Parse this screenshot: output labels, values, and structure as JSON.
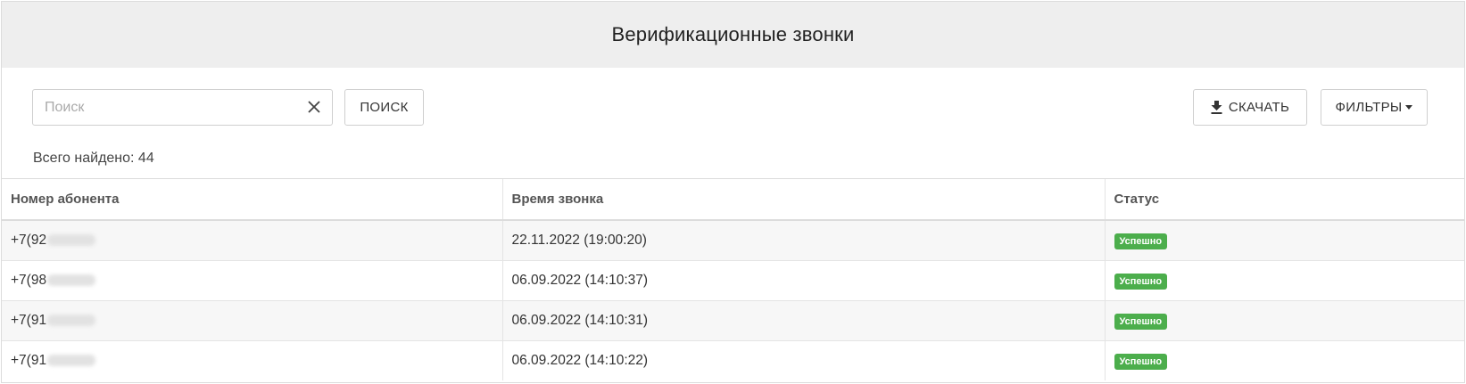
{
  "header": {
    "title": "Верификационные звонки"
  },
  "search": {
    "placeholder": "Поиск",
    "value": ""
  },
  "toolbar": {
    "search_label": "ПОИСК",
    "download_label": "СКАЧАТЬ",
    "filters_label": "ФИЛЬТРЫ"
  },
  "total": {
    "text": "Всего найдено: 44"
  },
  "table": {
    "columns": [
      "Номер абонента",
      "Время звонка",
      "Статус"
    ],
    "rows": [
      {
        "phone": "+7(92",
        "time": "22.11.2022 (19:00:20)",
        "status": "Успешно"
      },
      {
        "phone": "+7(98",
        "time": "06.09.2022 (14:10:37)",
        "status": "Успешно"
      },
      {
        "phone": "+7(91",
        "time": "06.09.2022 (14:10:31)",
        "status": "Успешно"
      },
      {
        "phone": "+7(91",
        "time": "06.09.2022 (14:10:22)",
        "status": "Успешно"
      }
    ]
  },
  "colors": {
    "header_bg": "#eeeeee",
    "success_badge": "#4cae4c",
    "stripe": "#f7f7f7"
  },
  "icons": [
    "close-icon",
    "download-icon",
    "caret-down-icon"
  ]
}
